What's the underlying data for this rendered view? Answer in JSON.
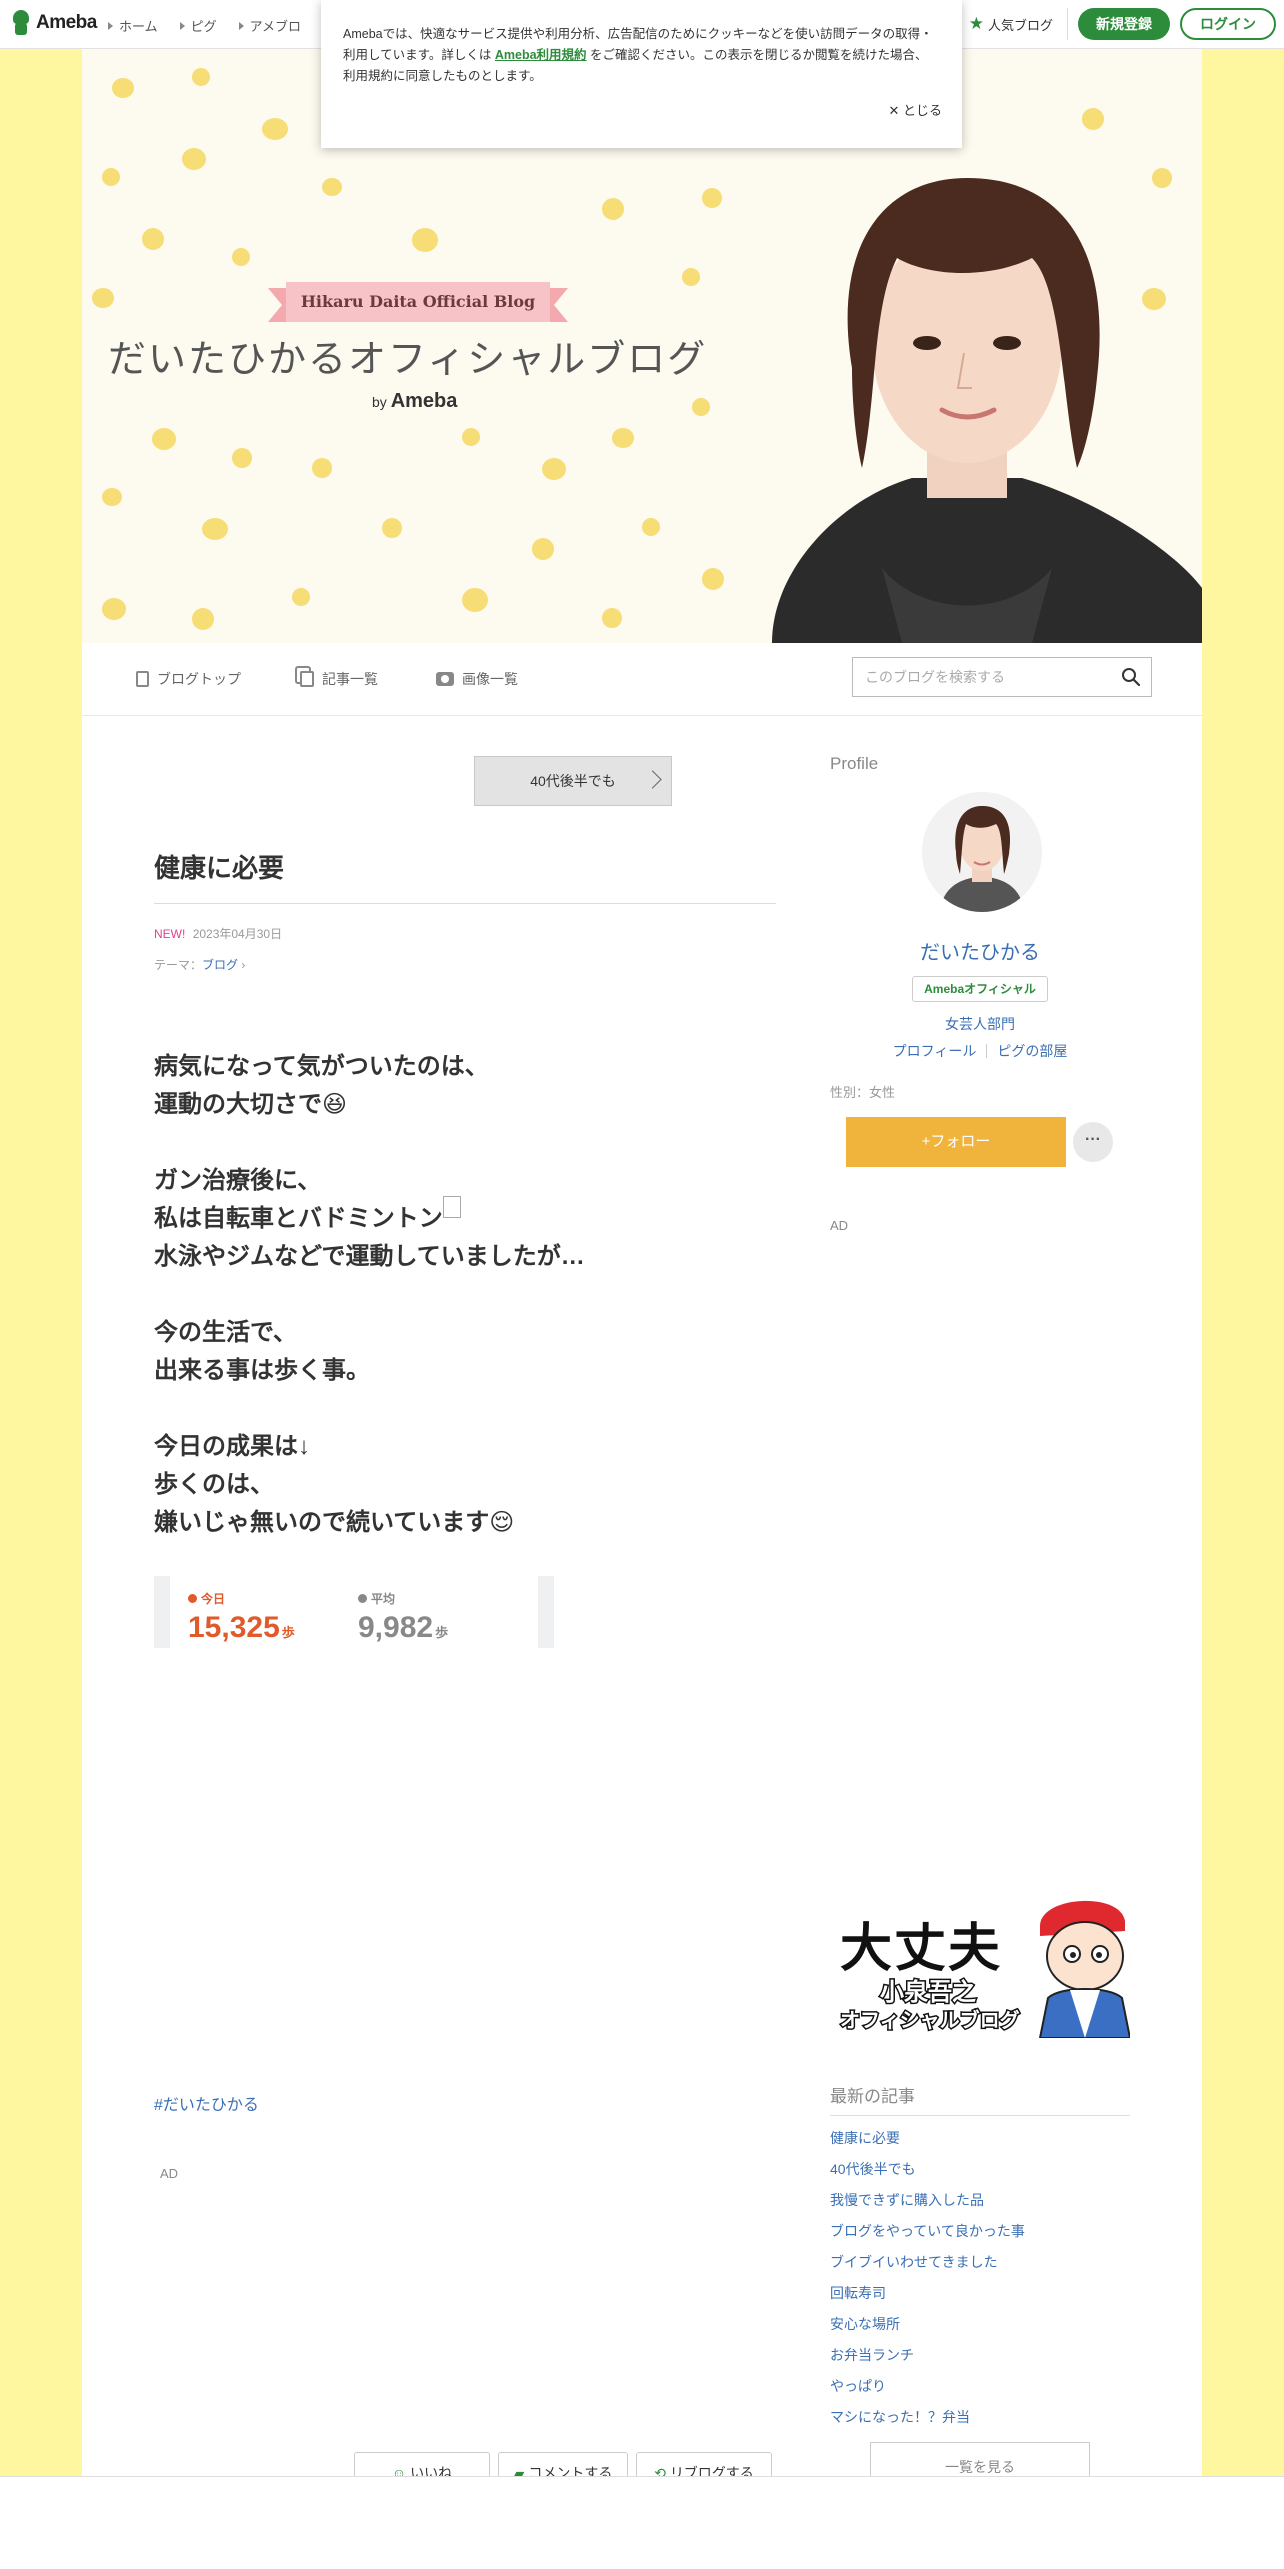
{
  "topbar": {
    "logo_text": "Ameba",
    "nav": [
      "ホーム",
      "ピグ",
      "アメブロ"
    ],
    "popular": "人気ブログ",
    "register": "新規登録",
    "login": "ログイン"
  },
  "cookie": {
    "text1": "Amebaでは、快適なサービス提供や利用分析、広告配信のためにクッキーなどを使い訪問データの取得・利用しています。詳しくは",
    "link": "Ameba利用規約",
    "text2": "をご確認ください。この表示を閉じるか閲覧を続けた場合、利用規約に同意したものとします。",
    "close": "とじる"
  },
  "header": {
    "ribbon": "Hikaru Daita Official Blog",
    "title": "だいたひかるオフィシャルブログ",
    "by": "by",
    "ameba": "Ameba"
  },
  "nav": {
    "top": "ブログトップ",
    "entries": "記事一覧",
    "images": "画像一覧",
    "search_placeholder": "このブログを検索する"
  },
  "article": {
    "prev": "40代後半でも",
    "title": "健康に必要",
    "new": "NEW!",
    "date": "2023年04月30日",
    "theme_label": "テーマ：",
    "theme": "ブログ",
    "p1_l1": "病気になって気がついたのは、",
    "p1_l2": "運動の大切さで",
    "p2_l1": "ガン治療後に、",
    "p2_l2": "私は自転車とバドミントン",
    "p2_l3": "水泳やジムなどで運動していましたが…",
    "p3_l1": "今の生活で、",
    "p3_l2": "出来る事は歩く事。",
    "p4_l1": "今日の成果は↓",
    "p4_l2": "歩くのは、",
    "p4_l3": "嫌いじゃ無いので続いています",
    "hashtag": "#だいたひかる",
    "ad": "AD"
  },
  "steps": {
    "today_label": "今日",
    "today_value": "15,325",
    "avg_label": "平均",
    "avg_value": "9,982",
    "unit": "歩",
    "today_color": "#e05a2b",
    "avg_color": "#888888"
  },
  "actions": {
    "like": "いいね",
    "comment": "コメントする",
    "reblog": "リブログする"
  },
  "sidebar": {
    "profile_label": "Profile",
    "name": "だいたひかる",
    "badge": "Amebaオフィシャル",
    "category": "女芸人部門",
    "profile_link": "プロフィール",
    "pigg_link": "ピグの部屋",
    "gender": "性別：女性",
    "follow": "フォロー",
    "ad": "AD",
    "banner_l1": "大丈夫",
    "banner_l2": "小泉吾之",
    "banner_l3": "オフィシャルブログ",
    "recent_label": "最新の記事",
    "recent": [
      "健康に必要",
      "40代後半でも",
      "我慢できずに購入した品",
      "ブログをやっていて良かった事",
      "ブイブイいわせてきました",
      "回転寿司",
      "安心な場所",
      "お弁当ランチ",
      "やっぱり",
      "マシになった！？弁当"
    ],
    "list_all": "一覧を見る"
  },
  "colors": {
    "brand_green": "#2d8c3c",
    "follow_yellow": "#f0b43c",
    "link_blue": "#3b6fb5",
    "background": "#fff79f"
  }
}
